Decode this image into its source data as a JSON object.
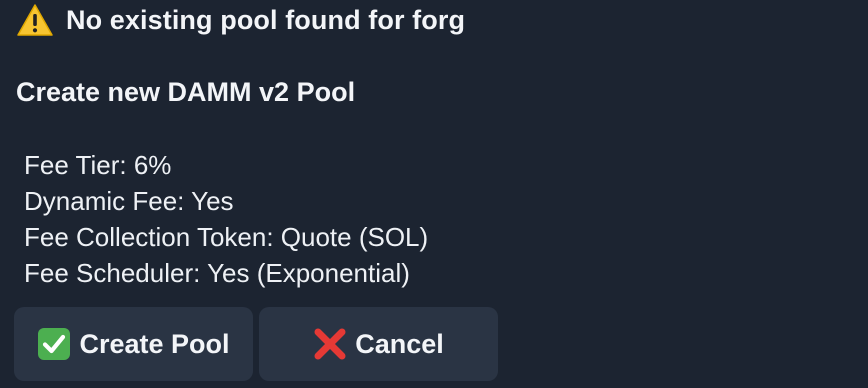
{
  "message": {
    "warning_text": "No existing pool found for forg",
    "title": "Create new DAMM v2 Pool",
    "details": [
      "Fee Tier: 6%",
      "Dynamic Fee: Yes",
      "Fee Collection Token: Quote (SOL)",
      "Fee Scheduler: Yes (Exponential)"
    ]
  },
  "buttons": {
    "create_label": "Create Pool",
    "cancel_label": "Cancel"
  },
  "icons": {
    "warning": "warning-icon",
    "create": "check-mark-icon",
    "cancel": "cross-mark-icon"
  },
  "colors": {
    "background": "#1c2431",
    "button_bg": "#2a3444",
    "warning_yellow": "#f7c531",
    "check_green": "#4caf50",
    "cross_red": "#e53935"
  }
}
